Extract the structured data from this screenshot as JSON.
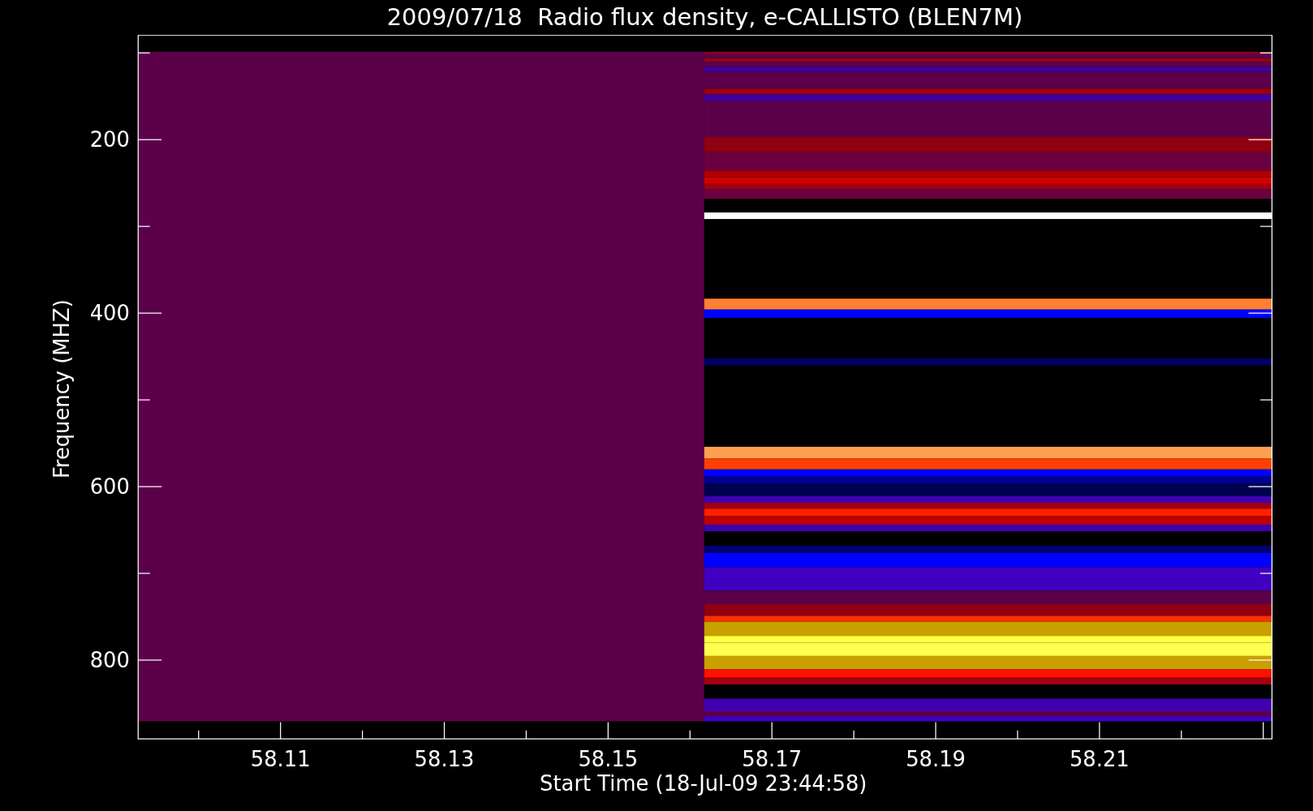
{
  "title": "2009/07/18  Radio flux density, e-CALLISTO (BLEN7M)",
  "y_axis": {
    "label": "Frequency (MHZ)",
    "ticks": [
      "200",
      "400",
      "600",
      "800"
    ]
  },
  "x_axis": {
    "label": "Start Time (18-Jul-09 23:44:58)",
    "ticks": [
      "58.11",
      "58.13",
      "58.15",
      "58.17",
      "58.19",
      "58.21"
    ]
  }
}
